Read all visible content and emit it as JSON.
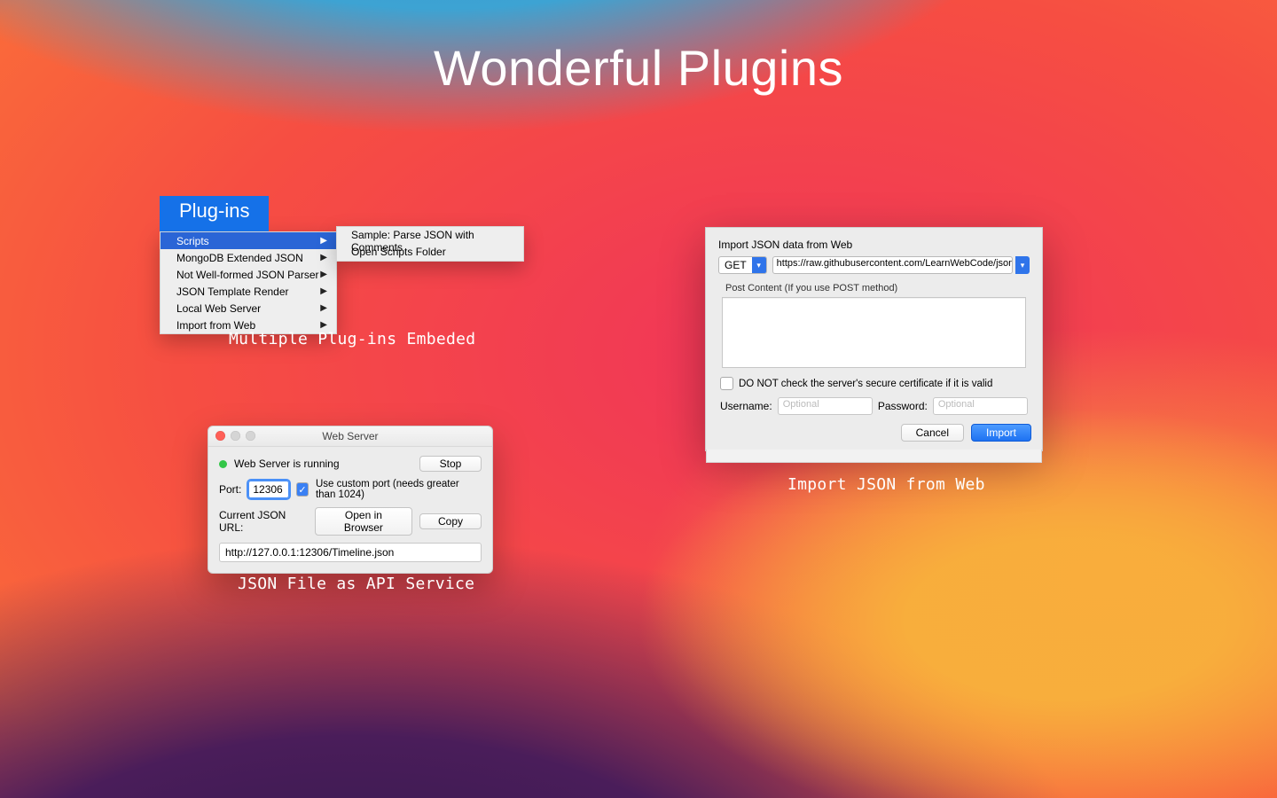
{
  "title": "Wonderful Plugins",
  "captions": {
    "plugins": "Multiple Plug-ins Embeded",
    "webserver": "JSON File as API Service",
    "import": "Import JSON from Web"
  },
  "menu": {
    "header": "Plug-ins",
    "items": [
      {
        "label": "Scripts",
        "selected": true
      },
      {
        "label": "MongoDB Extended JSON"
      },
      {
        "label": "Not Well-formed JSON Parser"
      },
      {
        "label": "JSON Template Render"
      },
      {
        "label": "Local Web Server"
      },
      {
        "label": "Import from Web"
      }
    ],
    "submenu": [
      "Sample: Parse JSON with Comments",
      "Open Scripts Folder"
    ]
  },
  "webserver": {
    "title": "Web Server",
    "status": "Web Server is running",
    "stop": "Stop",
    "port_label": "Port:",
    "port_value": "12306",
    "custom_port_label": "Use custom port (needs greater than 1024)",
    "current_url_label": "Current JSON URL:",
    "open_browser": "Open in Browser",
    "copy": "Copy",
    "url": "http://127.0.0.1:12306/Timeline.json"
  },
  "import": {
    "header": "Import JSON data from Web",
    "method": "GET",
    "url": "https://raw.githubusercontent.com/LearnWebCode/json-example",
    "post_label": "Post Content (If you use POST method)",
    "cert_label": "DO NOT check the server's secure certificate if it is valid",
    "username_label": "Username:",
    "password_label": "Password:",
    "placeholder": "Optional",
    "cancel": "Cancel",
    "import_btn": "Import"
  }
}
